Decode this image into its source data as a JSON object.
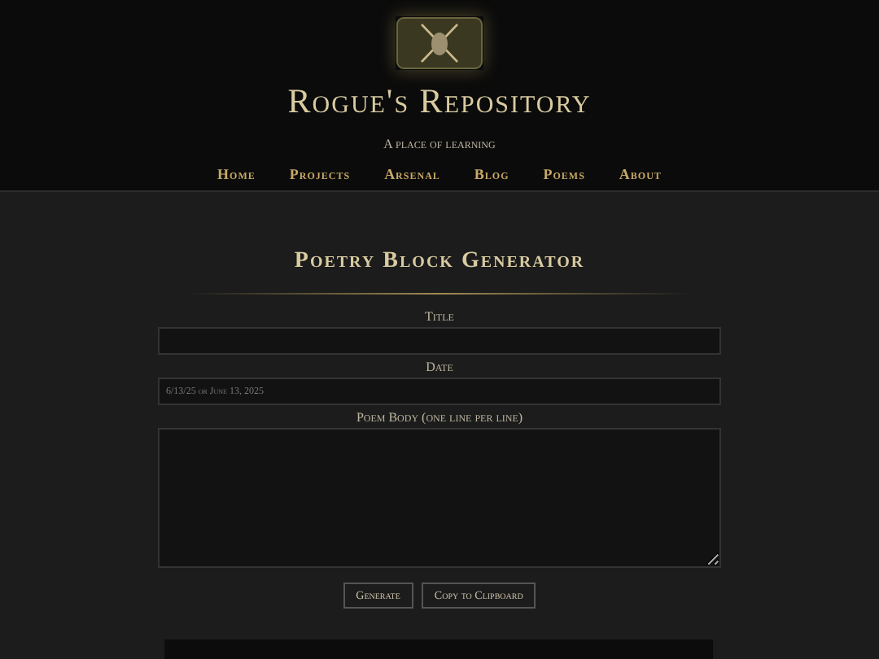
{
  "site": {
    "title": "Rogue's Repository",
    "tagline": "A place of learning"
  },
  "nav": [
    {
      "label": "Home"
    },
    {
      "label": "Projects"
    },
    {
      "label": "Arsenal"
    },
    {
      "label": "Blog"
    },
    {
      "label": "Poems"
    },
    {
      "label": "About"
    }
  ],
  "heading": "Poetry Block Generator",
  "fields": [
    {
      "label": "Title",
      "kind": "input"
    },
    {
      "label": "Date",
      "kind": "input",
      "placeholder": "6/13/25 or June 13, 2025"
    },
    {
      "label": "Poem Body (one line per line)",
      "kind": "textarea"
    }
  ],
  "buttons": [
    "Generate",
    "Copy to Clipboard"
  ]
}
